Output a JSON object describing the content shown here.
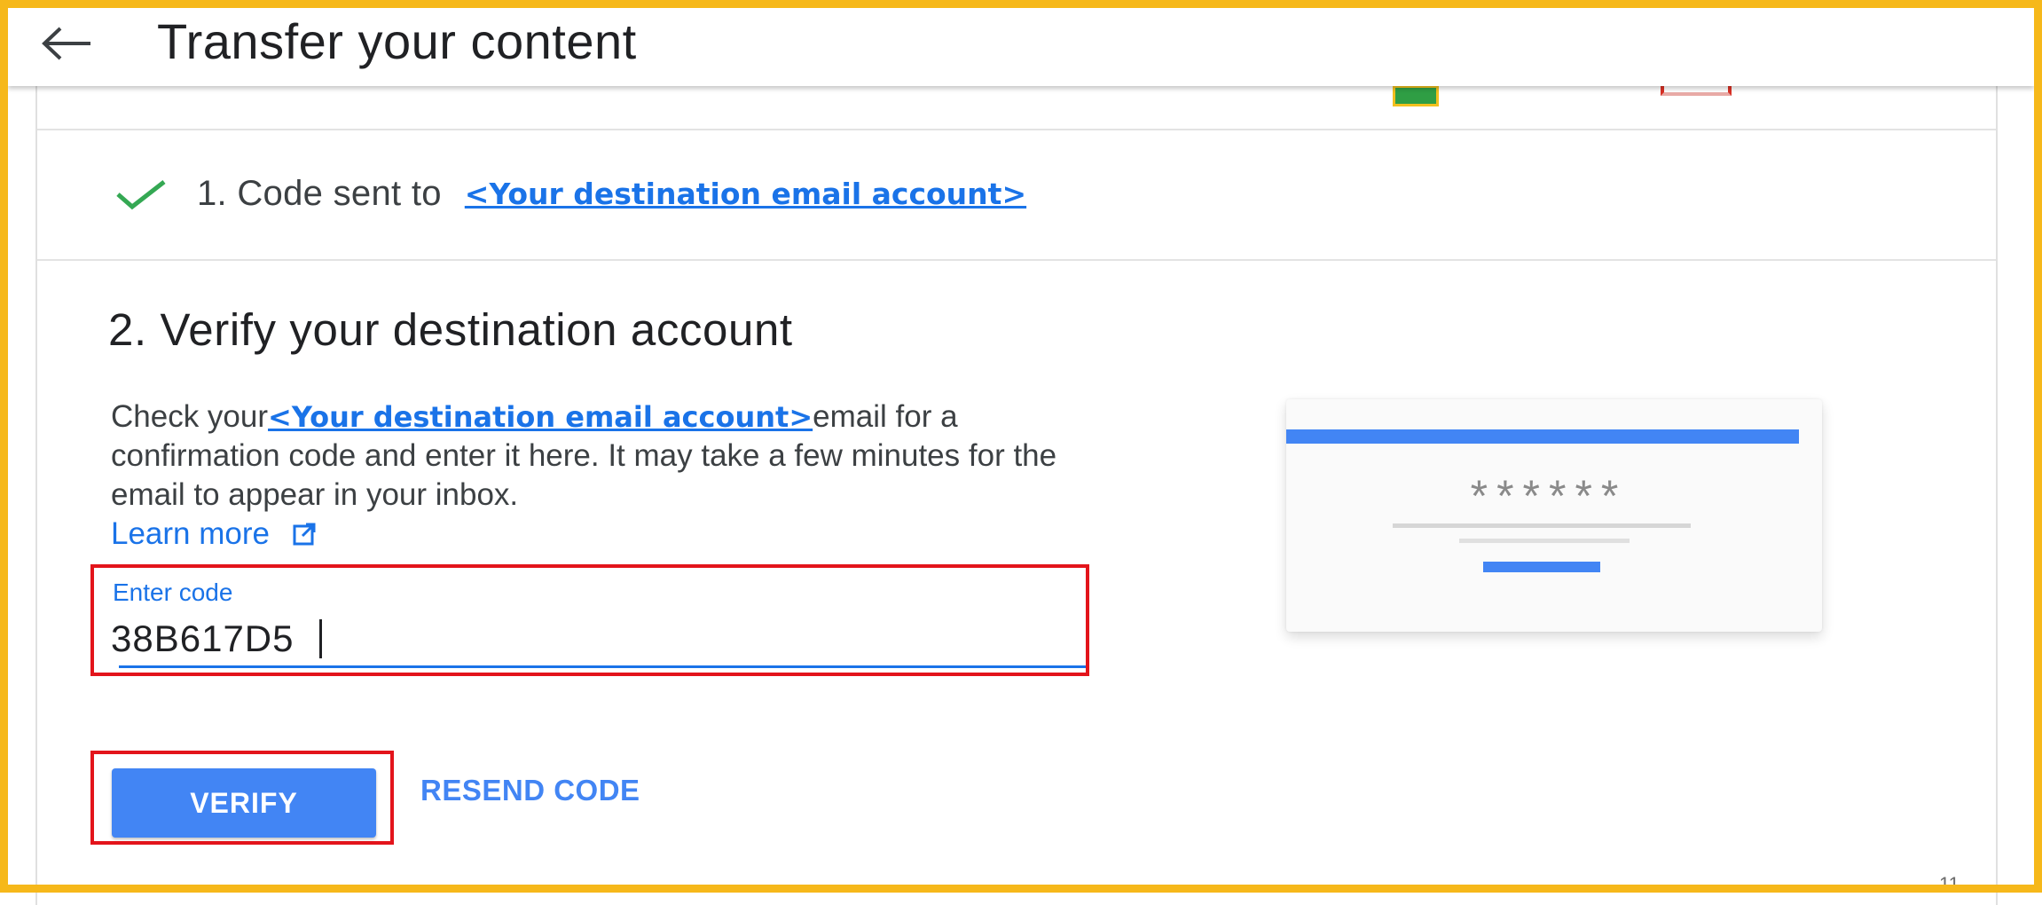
{
  "header": {
    "title": "Transfer your content",
    "back_icon": "arrow-left-icon"
  },
  "step1": {
    "check_icon": "checkmark-icon",
    "text": "1. Code sent to",
    "email": "<Your destination email account>"
  },
  "step2": {
    "title": "2. Verify your destination account",
    "desc_prefix": "Check your",
    "desc_email": "<Your destination email account>",
    "desc_rest": "email for a confirmation code and enter it here. It may take a few minutes for the email to appear in your inbox.",
    "learn_more": "Learn more",
    "learn_more_icon": "open-in-new-icon"
  },
  "code_field": {
    "label": "Enter code",
    "value": "38B617D5"
  },
  "buttons": {
    "verify": "VERIFY",
    "resend": "RESEND CODE"
  },
  "illustration": {
    "masked_code": "******"
  },
  "page_number": "11",
  "colors": {
    "frame": "#f6b81a",
    "accent": "#1a73e8",
    "button": "#4285f4",
    "highlight_box": "#e3141b",
    "check": "#34a853"
  }
}
